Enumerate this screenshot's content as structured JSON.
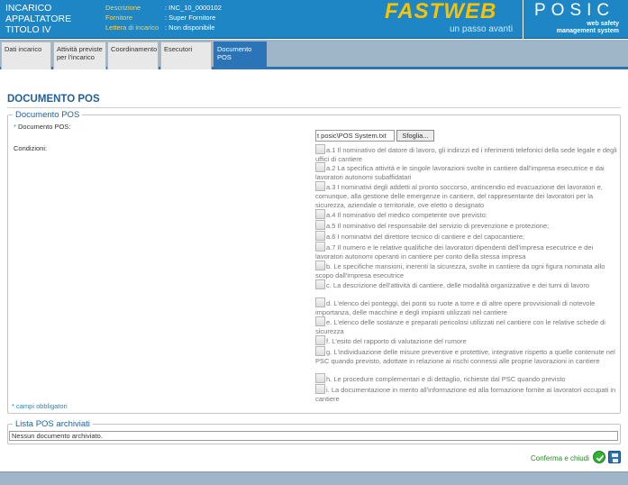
{
  "header": {
    "title_lines": [
      "INCARICO",
      "APPALTATORE",
      "TITOLO IV"
    ],
    "info": [
      {
        "key": "Descrizione",
        "value": ": INC_10_0000102"
      },
      {
        "key": "Fornitore",
        "value": ": Super Fornitore"
      },
      {
        "key": "Lettera di incarico",
        "value": ": Non disponibile"
      }
    ],
    "brand": "FASTWEB",
    "brand_tagline": "un passo avanti",
    "product": "POSIC",
    "product_sub": [
      "web safety",
      "management system"
    ]
  },
  "tabs": [
    {
      "label": "Dati incarico",
      "active": false
    },
    {
      "label": "Attività previste per l'incarico",
      "active": false
    },
    {
      "label": "Coordinamento",
      "active": false
    },
    {
      "label": "Esecutori",
      "active": false
    },
    {
      "label": "Documento POS",
      "active": true
    }
  ],
  "page_title": "DOCUMENTO POS",
  "form": {
    "legend": "Documento POS",
    "doc_label": "Documento POS:",
    "req_mark": "*",
    "file_value": "t posic\\POS System.txt",
    "browse_label": "Sfoglia...",
    "conditions_label": "Condizioni:",
    "conditions": [
      "a.1 Il nominativo del datore di lavoro, gli indirizzi ed i riferimenti telefonici della sede legale e degli uffici di cantiere",
      "a.2 La specifica attività e le singole lavorazioni svolte in cantiere dall'impresa esecutrice e dai lavoratori autonomi subaffidatari",
      "a.3 I nominativi degli addetti al pronto soccorso, antincendio ed evacuazione dei lavoratori e, comunque, alla gestione delle emergenze in cantiere, del rappresentante dei lavoratori per la sicurezza, aziendale o territoriale, ove eletto o designato",
      "a.4 Il nominativo del medico competente ove previsto:",
      "a.5 Il nominativo del responsabile del servizio di prevenzione e protezione;",
      "a.6 I nominativi del direttore tecnico di cantiere e del capocantiere;",
      "a.7 Il numero e le relative qualifiche dei lavoratori dipendenti dell'impresa esecutrice e dei lavoratori autonomi operanti in cantiere per conto della stessa impresa",
      "b. Le specifiche mansioni, inerenti la sicurezza, svolte in cantiere da ogni figura nominata allo scopo dall'impresa esecutrice",
      "c. La descrizione dell'attività di cantiere, delle modalità organizzative e dei turni di lavoro",
      "d. L'elenco dei ponteggi, dei ponti su ruote a torre e di altre opere provvisionali di notevole importanza, delle macchine e degli impianti utilizzati nel cantiere",
      "e. L'elenco delle sostanze e preparati pericolosi utilizzati nel cantiere con le relative schede di sicurezza",
      "f. L'esito del rapporto di valutazione del rumore",
      "g. L'individuazione delle misure preventive e protettive, integrative rispetto a quelle contenute nel PSC quando previsto, adottate in relazione ai rischi connessi alle proprie lavorazioni in cantiere",
      "h. Le procedure complementari e di dettaglio, richieste dal PSC quando previsto",
      "i. La documentazione in merito all'informazione ed alla formazione fornite ai lavoratori occupati in cantiere"
    ],
    "required_note": "* campi obbligatori"
  },
  "archive": {
    "legend": "Lista POS archiviati",
    "value": "Nessun documento archiviato."
  },
  "actions": {
    "confirm_label": "Conferma e chiudi"
  },
  "colors": {
    "header_blue": "#1e86c4",
    "active_tab": "#2b74b8",
    "brand_yellow": "#f7c200",
    "confirm_green": "#2a8a2a"
  }
}
